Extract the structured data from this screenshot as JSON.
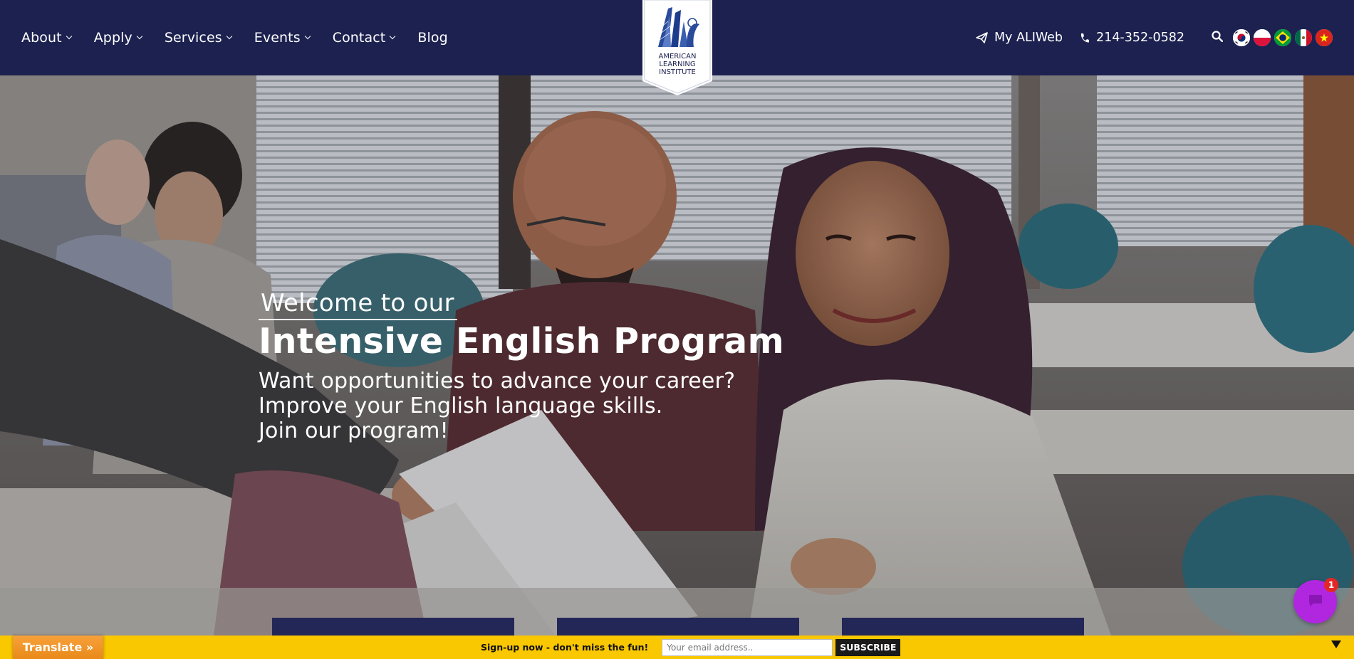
{
  "nav": {
    "items": [
      {
        "label": "About",
        "dropdown": true
      },
      {
        "label": "Apply",
        "dropdown": true
      },
      {
        "label": "Services",
        "dropdown": true
      },
      {
        "label": "Events",
        "dropdown": true
      },
      {
        "label": "Contact",
        "dropdown": true
      },
      {
        "label": "Blog",
        "dropdown": false
      }
    ]
  },
  "logo": {
    "line1": "AMERICAN",
    "line2": "LEARNING",
    "line3": "INSTITUTE"
  },
  "utility": {
    "portal_label": "My ALIWeb",
    "portal_icon": "paper-plane-icon",
    "phone_label": "214-352-0582",
    "phone_icon": "phone-icon",
    "search_icon": "search-icon"
  },
  "flags": [
    "korea",
    "poland",
    "brazil",
    "mexico",
    "vietnam"
  ],
  "hero": {
    "welcome": "Welcome to our",
    "headline": "Intensive English Program",
    "lines": [
      "Want opportunities to advance your career?",
      "Improve your English language skills.",
      "Join our program!"
    ]
  },
  "footer": {
    "translate_label": "Translate »",
    "signup_label": "Sign-up now - don't miss the fun!",
    "email_placeholder": "Your email address..",
    "subscribe_label": "SUBSCRIBE"
  },
  "chat": {
    "badge": "1"
  },
  "colors": {
    "navy": "#1c2150",
    "footer_yellow": "#fac800",
    "translate_orange": "#f39c33",
    "chat_purple": "#b127e0"
  }
}
